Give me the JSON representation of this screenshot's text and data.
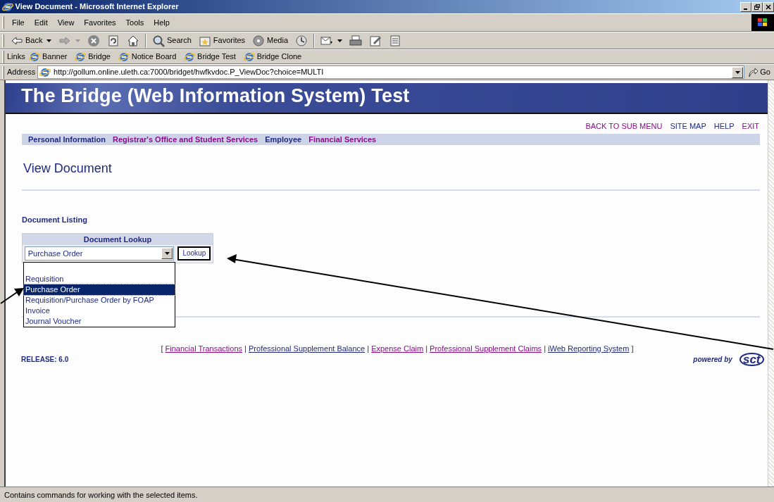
{
  "window": {
    "title": "View Document - Microsoft Internet Explorer"
  },
  "menu": [
    {
      "label": "File"
    },
    {
      "label": "Edit"
    },
    {
      "label": "View"
    },
    {
      "label": "Favorites"
    },
    {
      "label": "Tools"
    },
    {
      "label": "Help"
    }
  ],
  "toolbar": [
    {
      "kind": "back",
      "label": "Back"
    },
    {
      "kind": "forward"
    },
    {
      "kind": "stop"
    },
    {
      "kind": "refresh"
    },
    {
      "kind": "home"
    },
    {
      "kind": "search",
      "label": "Search"
    },
    {
      "kind": "favorites",
      "label": "Favorites"
    },
    {
      "kind": "media",
      "label": "Media"
    },
    {
      "kind": "history"
    },
    {
      "kind": "mail"
    },
    {
      "kind": "print"
    },
    {
      "kind": "edit"
    },
    {
      "kind": "discuss"
    }
  ],
  "links_bar": {
    "label": "Links",
    "items": [
      "Banner",
      "Bridge",
      "Notice Board",
      "Bridge Test",
      "Bridge Clone"
    ]
  },
  "address_bar": {
    "label": "Address",
    "value": "http://gollum.online.uleth.ca:7000/bridget/hwfkvdoc.P_ViewDoc?choice=MULTI",
    "go": "Go"
  },
  "page": {
    "banner_title": "The Bridge (Web Information System) Test",
    "top_links": [
      {
        "label": "BACK TO SUB MENU",
        "visited": true
      },
      {
        "label": "SITE MAP",
        "visited": false
      },
      {
        "label": "HELP",
        "visited": false
      },
      {
        "label": "EXIT",
        "visited": true
      }
    ],
    "nav": [
      {
        "label": "Personal Information",
        "visited": false
      },
      {
        "label": "Registrar's Office and Student Services",
        "visited": true
      },
      {
        "label": "Employee",
        "visited": false
      },
      {
        "label": "Financial Services",
        "visited": true
      }
    ],
    "heading": "View Document",
    "section_title": "Document Listing",
    "lookup": {
      "title": "Document Lookup",
      "value": "Purchase Order",
      "button": "Lookup",
      "expanded": true,
      "options": [
        {
          "label": "Requisition",
          "selected": false
        },
        {
          "label": "Purchase Order",
          "selected": true
        },
        {
          "label": "Requisition/Purchase Order by FOAP",
          "selected": false
        },
        {
          "label": "Invoice",
          "selected": false
        },
        {
          "label": "Journal Voucher",
          "selected": false
        }
      ]
    },
    "footer_links": [
      {
        "label": "Financial Transactions",
        "visited": true
      },
      {
        "label": "Professional Supplement Balance",
        "visited": false
      },
      {
        "label": "Expense Claim",
        "visited": true
      },
      {
        "label": "Professional Supplement Claims",
        "visited": true
      },
      {
        "label": "iWeb Reporting System",
        "visited": false
      }
    ],
    "footer_open": "[",
    "footer_separator": "|",
    "footer_close": "]",
    "release": "RELEASE: 6.0",
    "powered_by": "powered by",
    "logo_text": "sct"
  },
  "status_bar": "Contains commands for working with the selected items."
}
